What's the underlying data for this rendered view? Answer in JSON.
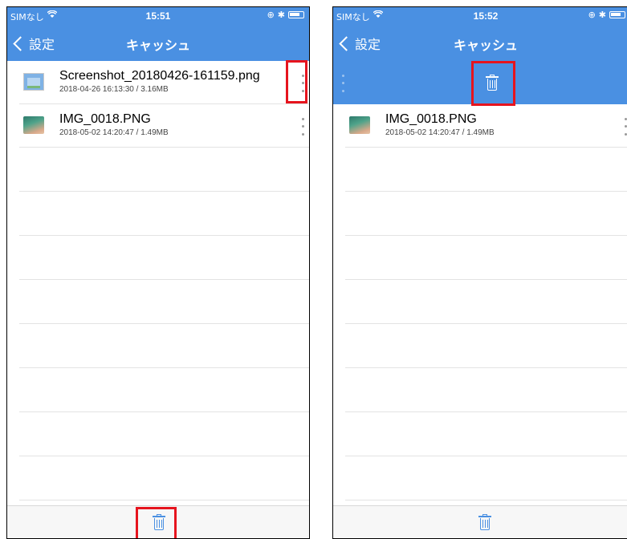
{
  "status_bar": {
    "carrier": "SIMなし",
    "left_time": "15:51",
    "right_time": "15:52",
    "icons": [
      "wifi-icon",
      "alarm-icon",
      "bluetooth-icon",
      "battery-icon"
    ]
  },
  "nav": {
    "back_label": "設定",
    "title": "キャッシュ"
  },
  "files_left": [
    {
      "name": "Screenshot_20180426-161159.png",
      "meta": "2018-04-26 16:13:30 / 3.16MB",
      "thumb": "image-thumbnail"
    },
    {
      "name": "IMG_0018.PNG",
      "meta": "2018-05-02 14:20:47 / 1.49MB",
      "thumb": "photo-thumbnail"
    }
  ],
  "files_right": [
    {
      "name": "IMG_0018.PNG",
      "meta": "2018-05-02 14:20:47 / 1.49MB",
      "thumb": "photo-thumbnail"
    }
  ],
  "colors": {
    "accent": "#4a90e2",
    "highlight": "#e6141e"
  }
}
